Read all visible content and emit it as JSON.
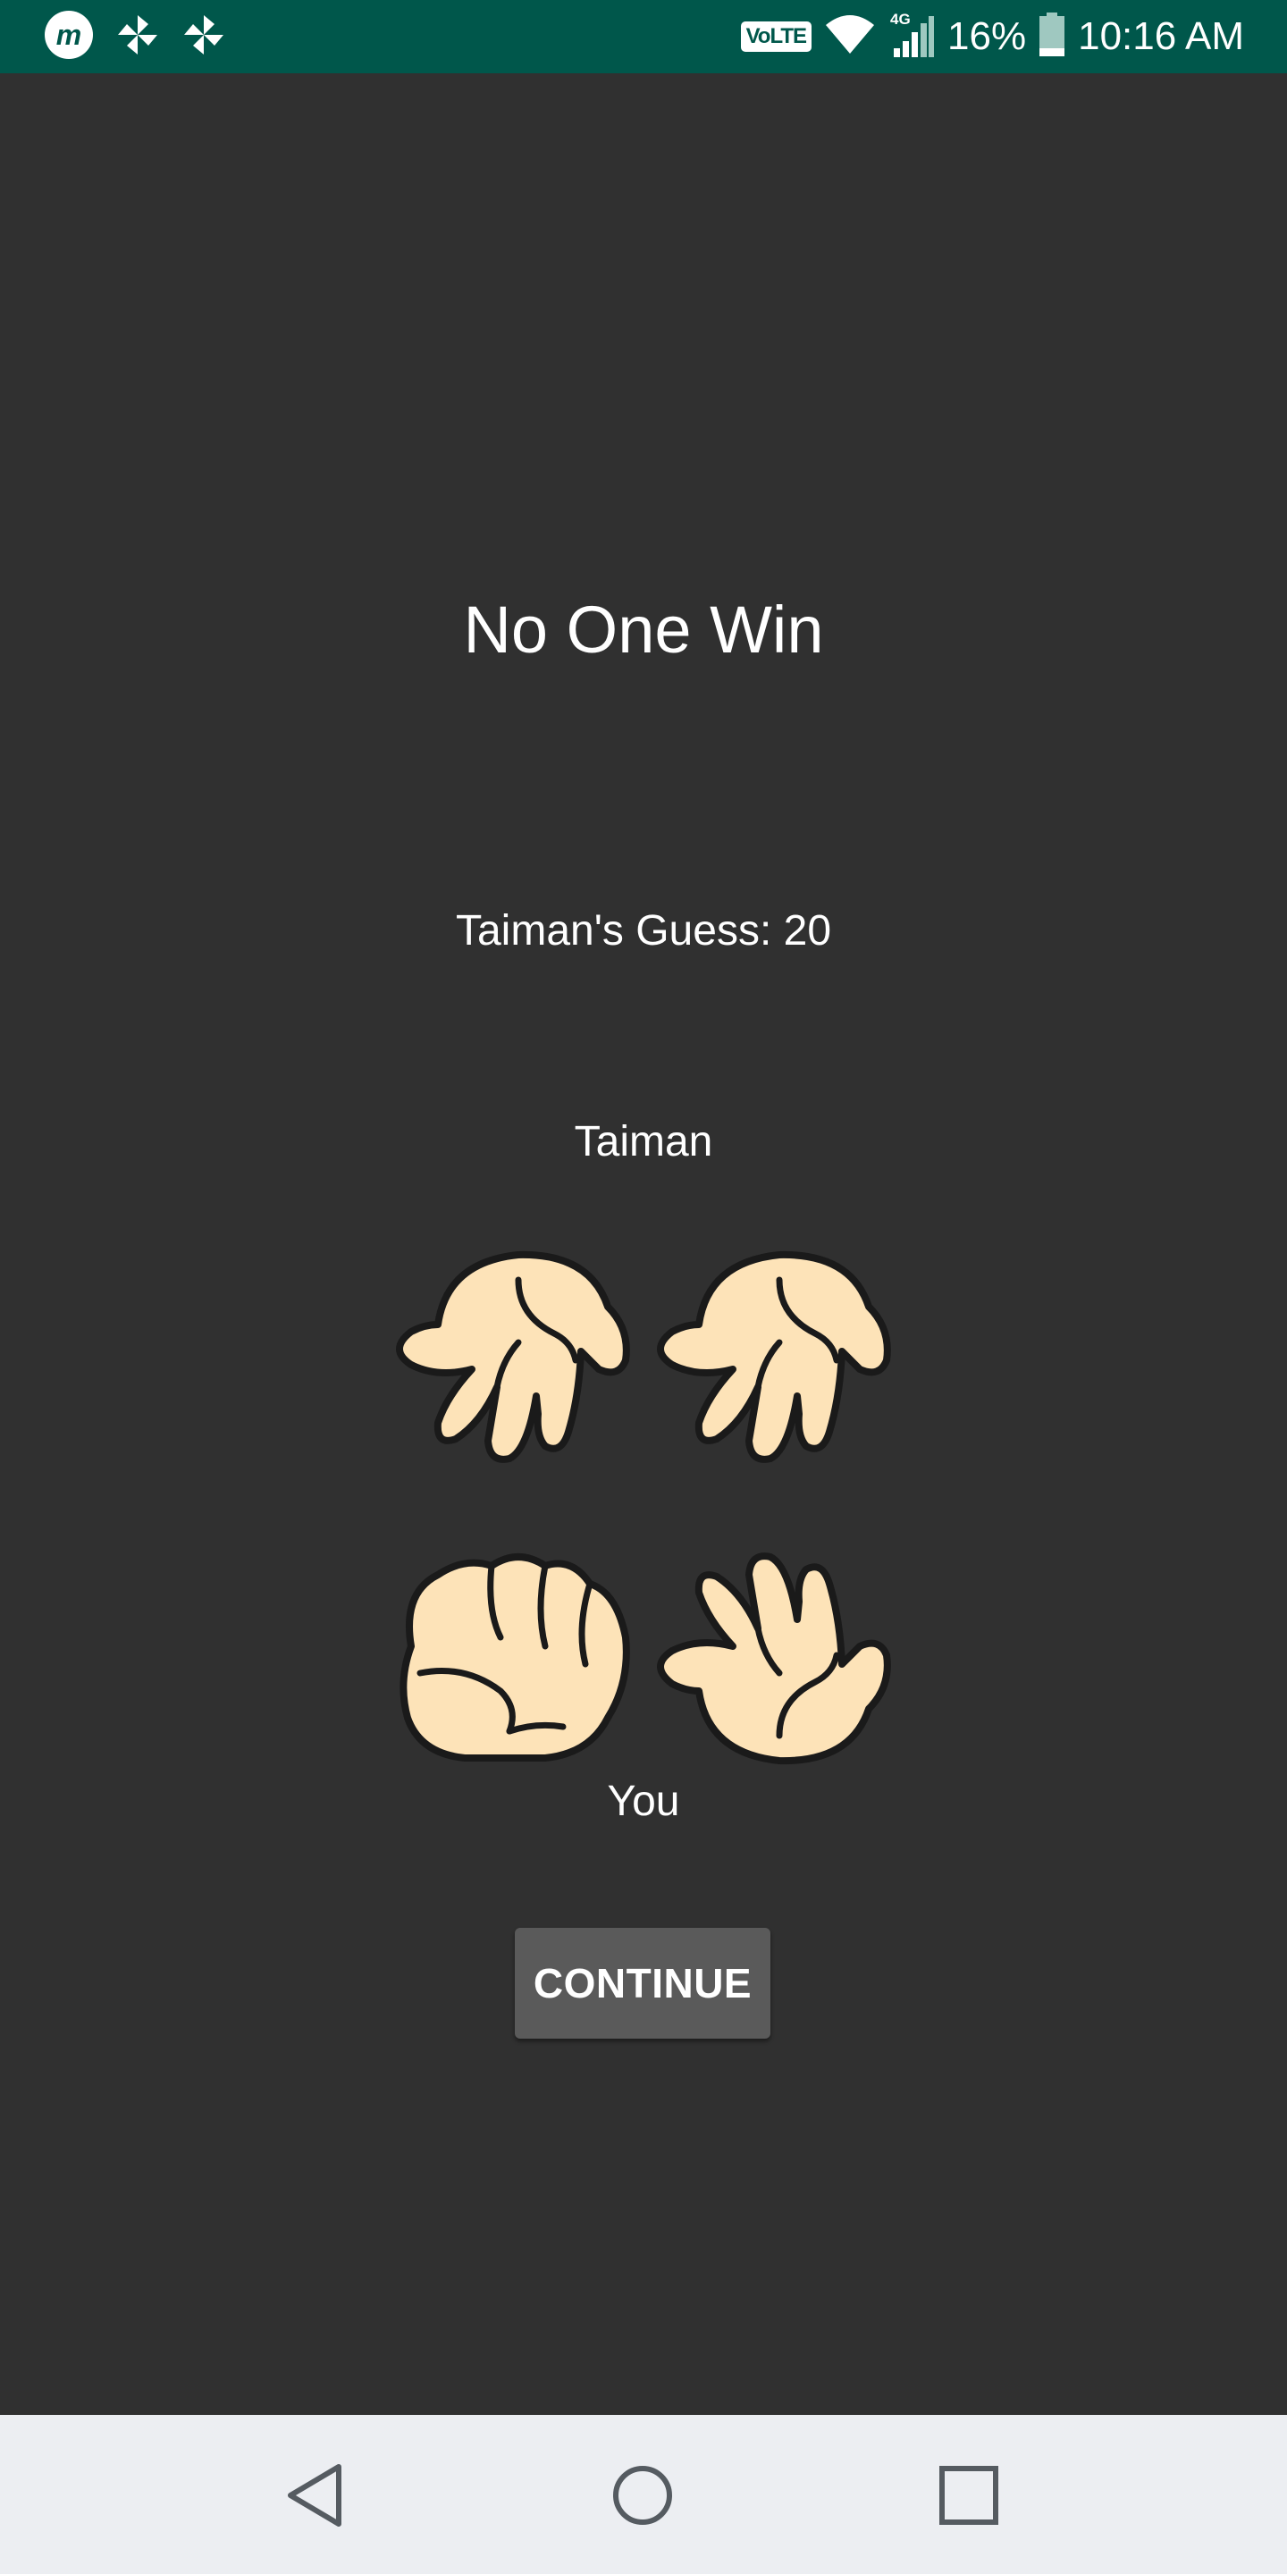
{
  "status_bar": {
    "left_icons": [
      "m-app-icon",
      "pinwheel-icon",
      "pinwheel-icon"
    ],
    "volte": "VoLTE",
    "network": "4G",
    "battery": "16%",
    "time": "10:16 AM"
  },
  "game": {
    "result": "No One Win",
    "guess": "Taiman's Guess: 20",
    "opponent_name": "Taiman",
    "player_label": "You",
    "opponent_hands": [
      "open-hand-icon",
      "open-hand-icon"
    ],
    "player_hands": [
      "fist-icon",
      "open-hand-icon"
    ],
    "continue_label": "CONTINUE"
  },
  "nav_bar": {
    "buttons": [
      "back-icon",
      "home-icon",
      "recents-icon"
    ]
  },
  "colors": {
    "status_bar": "#00574b",
    "background": "#303030",
    "button": "#5a5a5a",
    "hand_fill": "#fde3b8",
    "nav_bar": "#eceef2"
  }
}
